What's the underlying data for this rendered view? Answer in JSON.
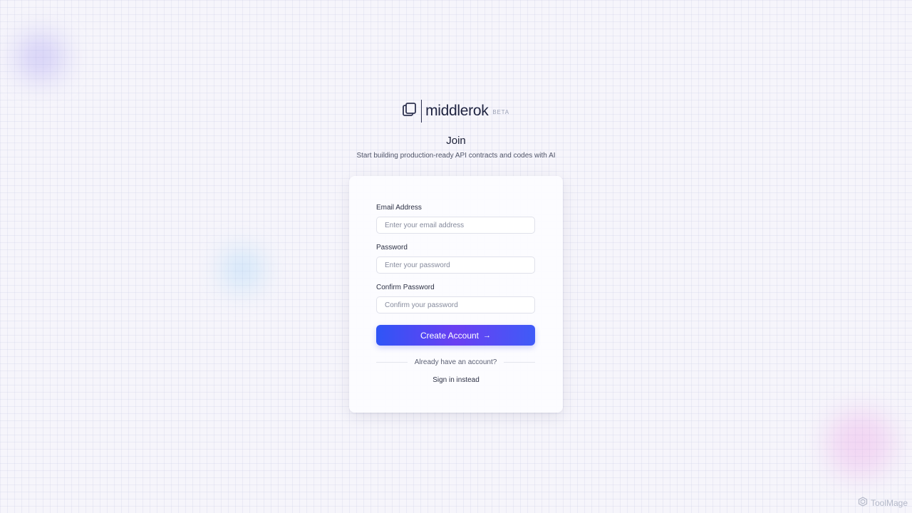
{
  "brand": {
    "name": "middlerok",
    "badge": "BETA"
  },
  "page": {
    "heading": "Join",
    "subheading": "Start building production-ready API contracts and codes with AI"
  },
  "form": {
    "email": {
      "label": "Email Address",
      "placeholder": "Enter your email address",
      "value": ""
    },
    "password": {
      "label": "Password",
      "placeholder": "Enter your password",
      "value": ""
    },
    "confirm_password": {
      "label": "Confirm Password",
      "placeholder": "Confirm your password",
      "value": ""
    },
    "submit_label": "Create Account",
    "submit_icon": "arrow-right-icon",
    "divider_text": "Already have an account?",
    "signin_link": "Sign in instead"
  },
  "watermark": {
    "text": "ToolMage",
    "icon": "toolmage-logo-icon"
  },
  "colors": {
    "accent_start": "#2f55f6",
    "accent_mid": "#6a3ff2",
    "text_primary": "#1b1f35"
  }
}
